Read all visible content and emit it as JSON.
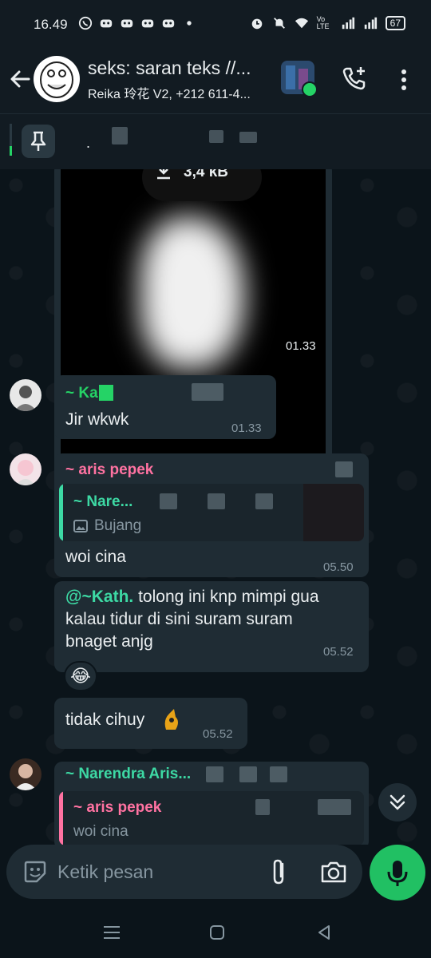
{
  "status_bar": {
    "time": "16.49",
    "battery": "67",
    "network": "Vo LTE",
    "icons": [
      "whatsapp-icon",
      "discord-icon",
      "discord-icon",
      "discord-icon",
      "discord-icon",
      "dot-icon",
      "alarm-icon",
      "mute-icon",
      "wifi-icon",
      "signal-icon",
      "signal-icon",
      "battery-icon"
    ]
  },
  "header": {
    "title": "seks: saran teks //...",
    "subtitle": "Reika 玲花 V2, +212 611-4...",
    "back_icon": "arrow-left-icon",
    "call_icon": "call-add-icon",
    "menu_icon": "more-vert-icon"
  },
  "pinned": {
    "icon": "pin-icon",
    "dot": "."
  },
  "messages": {
    "media": {
      "size_label": "3,4 kB",
      "time": "01.33"
    },
    "m1": {
      "sender": "~ Ka",
      "text": "Jir wkwk",
      "time": "01.33"
    },
    "m2": {
      "sender": "~ aris pepek",
      "quote_sender": "~ Nare...",
      "quote_text": "Bujang",
      "text": "woi cina",
      "time": "05.50"
    },
    "m3": {
      "mention": "@~Kath.",
      "text_line1": " tolong ini knp mimpi gua",
      "text_line2": "kalau tidur di sini suram suram",
      "text_line3": "bnaget anjg",
      "time": "05.52",
      "reaction": "😂"
    },
    "m4": {
      "text": "tidak cihuy",
      "time": "05.52"
    },
    "m5": {
      "sender": "~ Narendra Aris...",
      "quote_sender": "~ aris pepek",
      "quote_text": "woi cina"
    }
  },
  "composer": {
    "placeholder": "Ketik pesan"
  },
  "colors": {
    "background": "#0b141a",
    "bubble": "#1f2c34",
    "accent_green": "#21c063",
    "sender_green": "#25d366",
    "sender_pink": "#ff72a1",
    "sender_teal": "#3dd9a4",
    "meta_gray": "#8696a0"
  }
}
